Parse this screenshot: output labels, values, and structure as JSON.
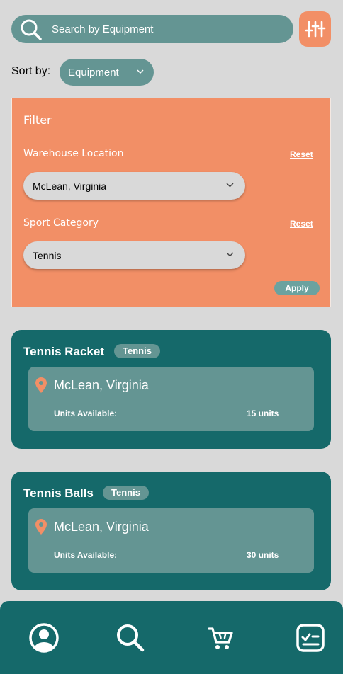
{
  "search": {
    "placeholder": "Search by Equipment"
  },
  "sort": {
    "label": "Sort by:",
    "value": "Equipment"
  },
  "filter": {
    "title": "Filter",
    "warehouse": {
      "label": "Warehouse Location",
      "reset": "Reset",
      "value": "McLean, Virginia"
    },
    "sport": {
      "label": "Sport Category",
      "reset": "Reset",
      "value": "Tennis"
    },
    "apply": "Apply"
  },
  "items": [
    {
      "name": "Tennis Racket",
      "tag": "Tennis",
      "location": "McLean, Virginia",
      "units_label": "Units Available:",
      "units": "15 units"
    },
    {
      "name": "Tennis Balls",
      "tag": "Tennis",
      "location": "McLean, Virginia",
      "units_label": "Units Available:",
      "units": "30 units"
    }
  ],
  "nav": [
    "profile-icon",
    "search-icon",
    "cart-icon",
    "checklist-icon"
  ],
  "colors": {
    "teal": "#15696a",
    "muted_teal": "#649593",
    "orange": "#f28f66",
    "background": "#d9d9d9"
  }
}
